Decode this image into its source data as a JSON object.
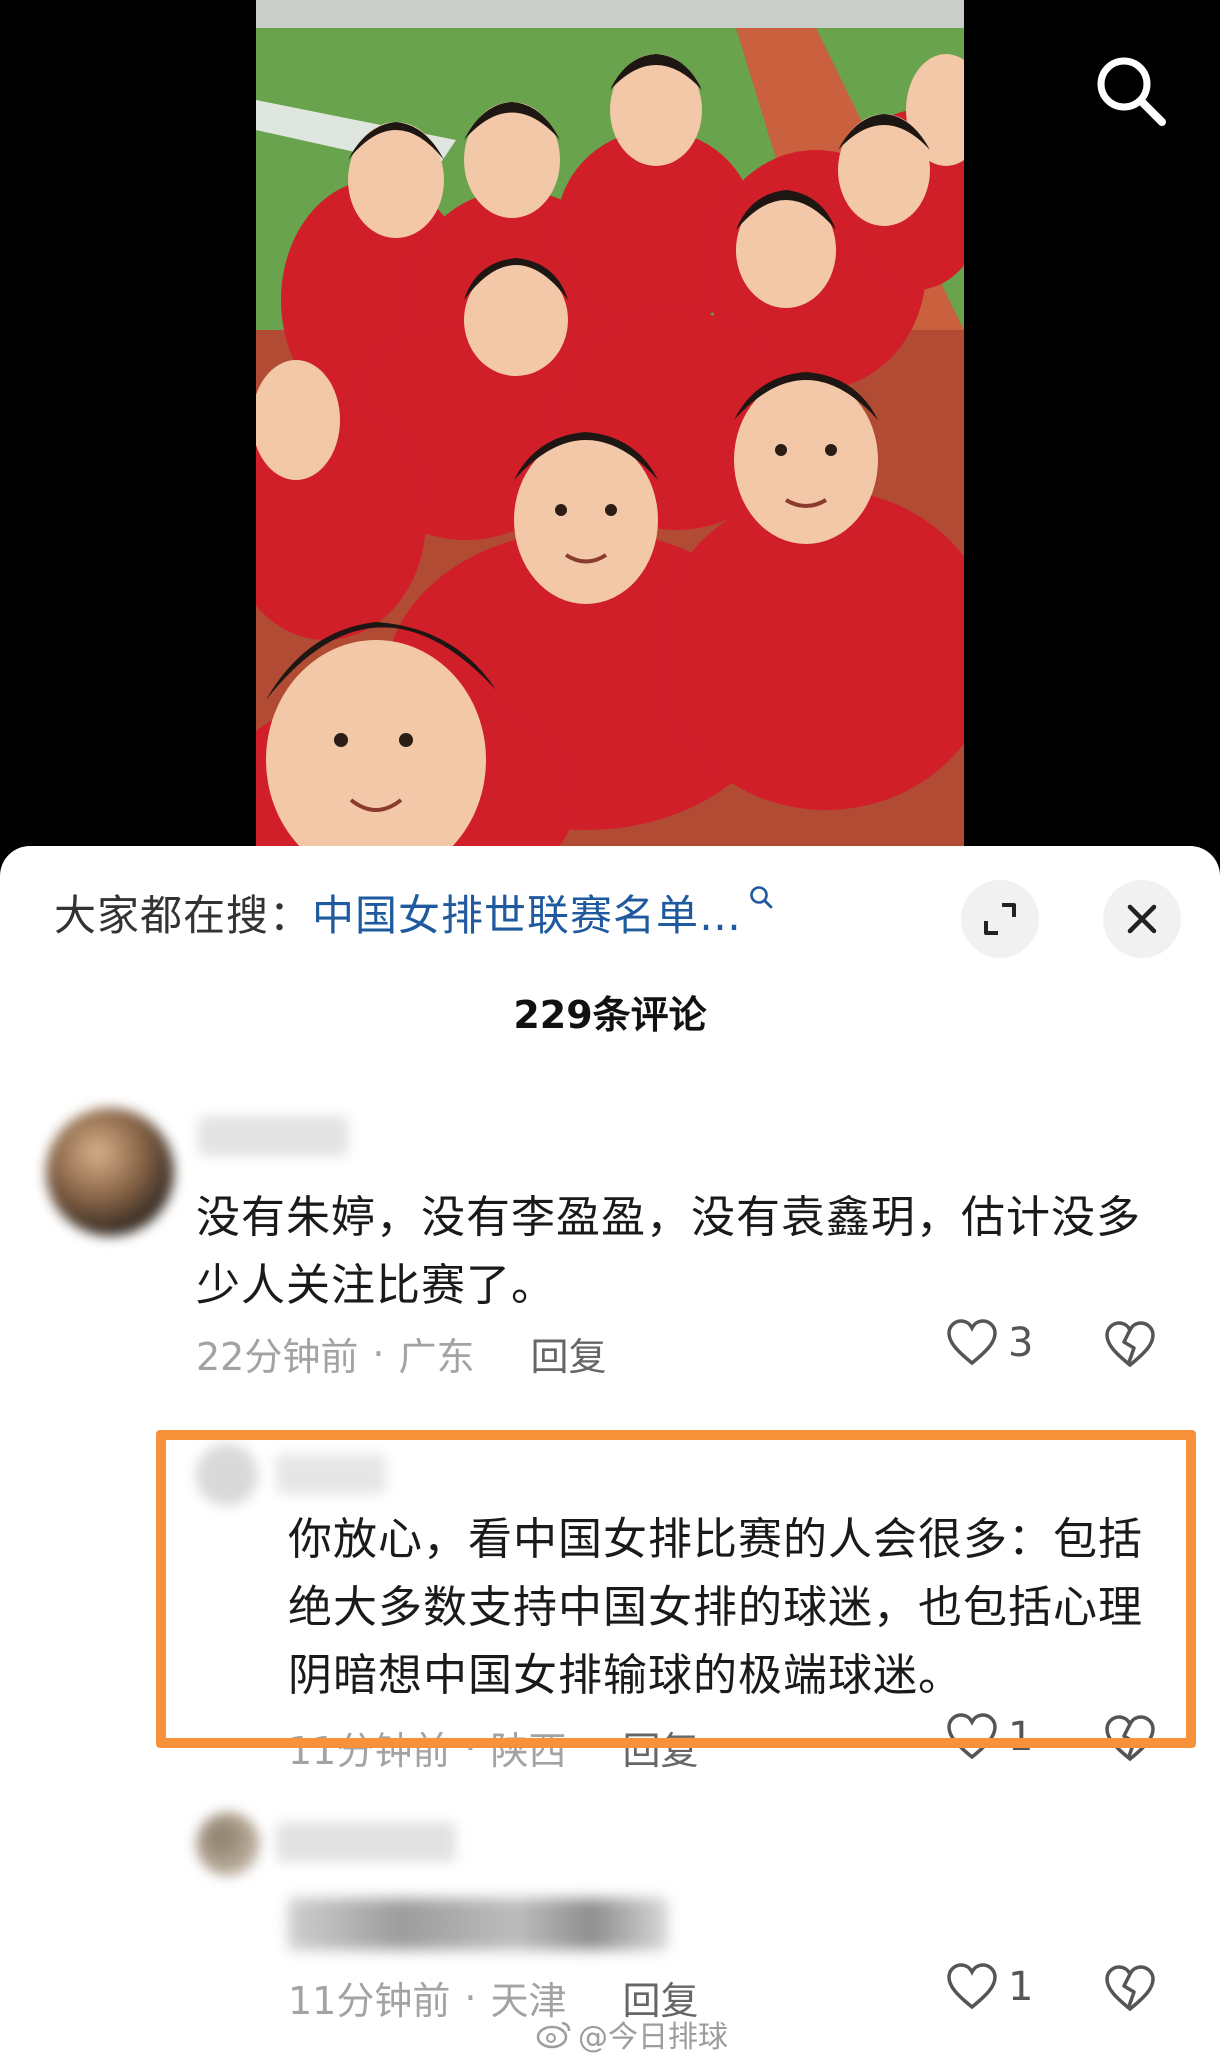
{
  "search": {
    "prefix": "大家都在搜：",
    "query": "中国女排世联赛名单…"
  },
  "comments_header": {
    "count_label": "229条评论"
  },
  "comments": [
    {
      "text": "没有朱婷，没有李盈盈，没有袁鑫玥，估计没多少人关注比赛了。",
      "time": "22分钟前",
      "location": "广东",
      "reply_label": "回复",
      "likes": "3"
    },
    {
      "text": "你放心，看中国女排比赛的人会很多：包括绝大多数支持中国女排的球迷，也包括心理阴暗想中国女排输球的极端球迷。",
      "time": "11分钟前",
      "location": "陕西",
      "reply_label": "回复",
      "likes": "1"
    },
    {
      "text": "",
      "time": "11分钟前",
      "location": "天津",
      "reply_label": "回复",
      "likes": "1"
    }
  ],
  "separator": "·",
  "watermark": "@今日排球",
  "icons": {
    "search": "search-icon",
    "expand": "expand-icon",
    "close": "close-icon",
    "like": "heart-icon",
    "dislike": "broken-heart-icon"
  },
  "colors": {
    "link": "#1f5a9e",
    "highlight_border": "#f7913a",
    "meta_text": "#a3a3a3"
  }
}
